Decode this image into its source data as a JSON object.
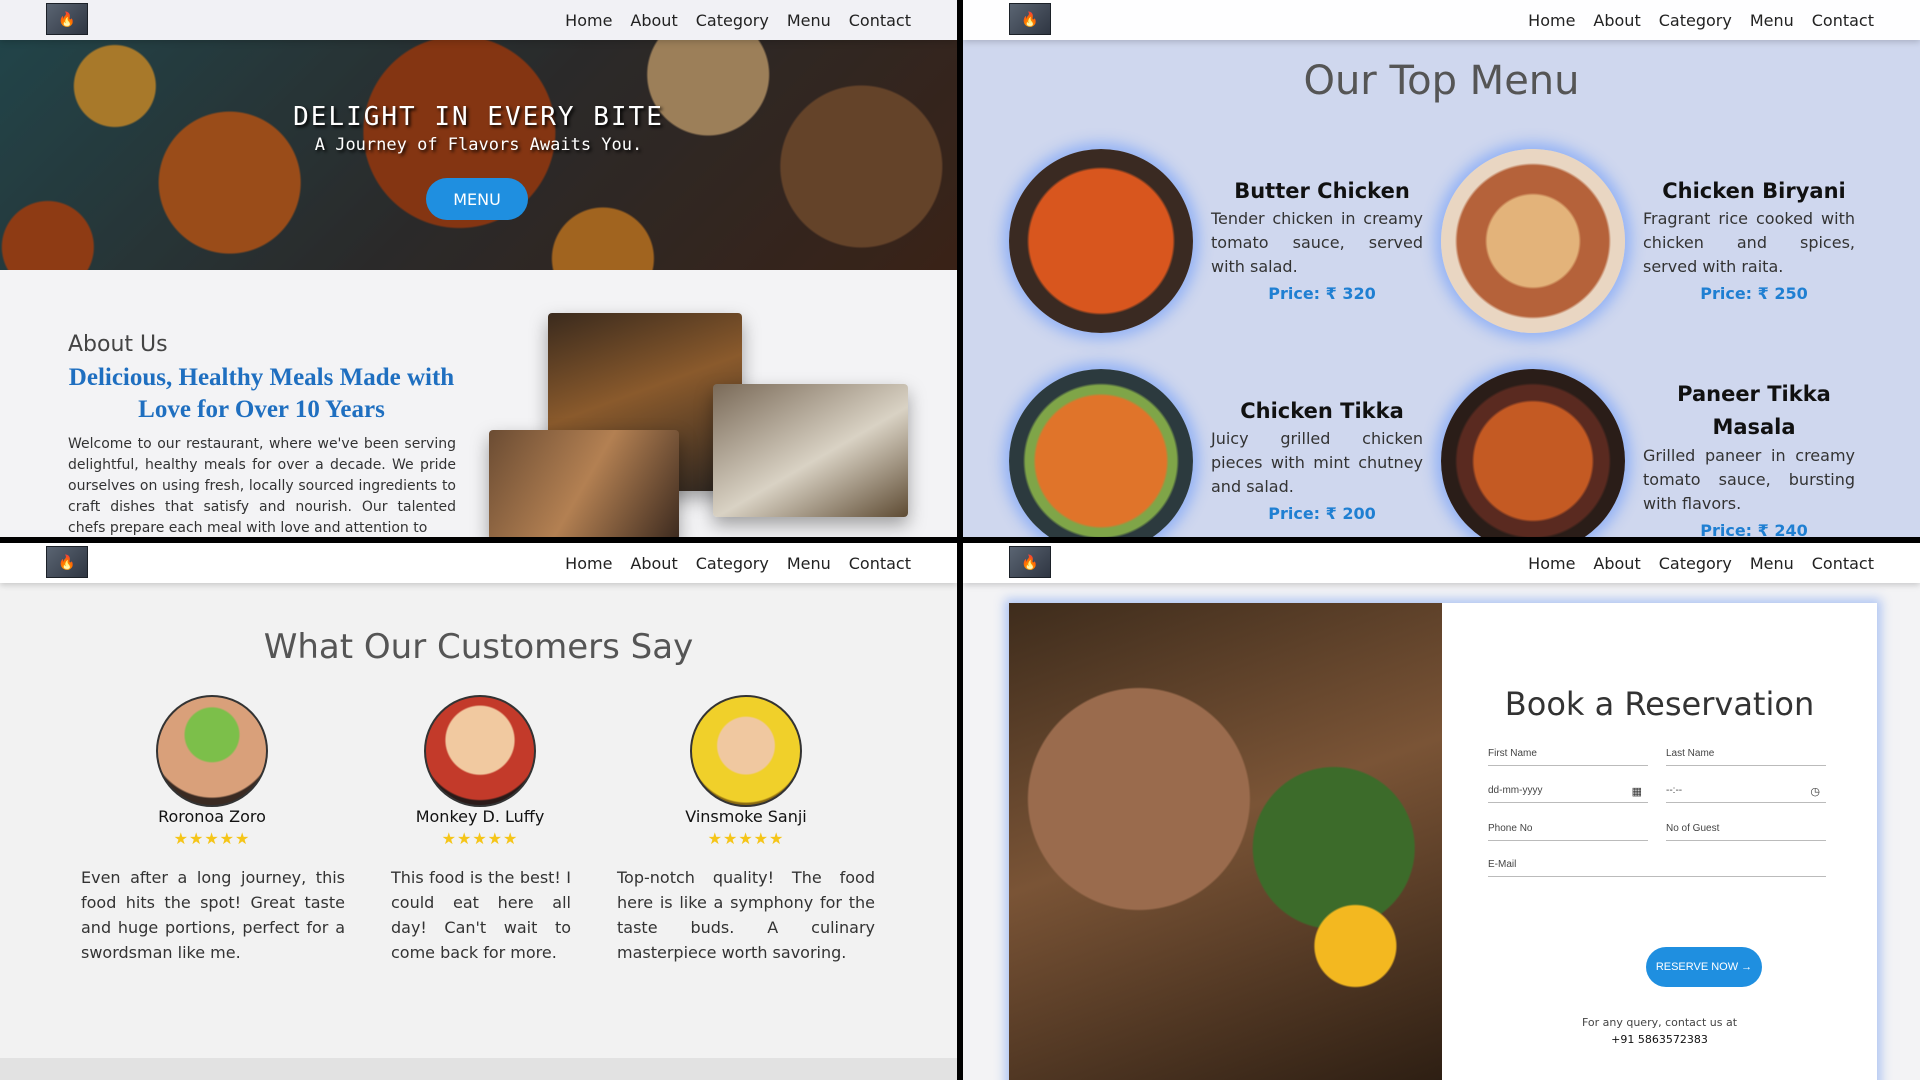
{
  "nav": {
    "links": [
      "Home",
      "About",
      "Category",
      "Menu",
      "Contact"
    ]
  },
  "hero": {
    "title": "DELIGHT IN EVERY BITE",
    "subtitle": "A Journey of Flavors Awaits You.",
    "button": "MENU"
  },
  "about": {
    "heading": "About Us",
    "title": "Delicious, Healthy Meals Made with Love for Over 10 Years",
    "body": "Welcome to our restaurant, where we've been serving delightful, healthy meals for over a decade. We pride ourselves on using fresh, locally sourced ingredients to craft dishes that satisfy and nourish. Our talented chefs prepare each meal with love and attention to"
  },
  "menu": {
    "title": "Our Top Menu",
    "items": [
      {
        "name": "Butter Chicken",
        "desc": "Tender chicken in creamy tomato sauce, served with salad.",
        "price": "Price: ₹ 320"
      },
      {
        "name": "Chicken Biryani",
        "desc": "Fragrant rice cooked with chicken and spices, served with raita.",
        "price": "Price: ₹ 250"
      },
      {
        "name": "Chicken Tikka",
        "desc": "Juicy grilled chicken pieces with mint chutney and salad.",
        "price": "Price: ₹ 200"
      },
      {
        "name": "Paneer Tikka Masala",
        "desc": "Grilled paneer in creamy tomato sauce, bursting with flavors.",
        "price": "Price: ₹ 240"
      }
    ]
  },
  "testimonials": {
    "title": "What Our Customers Say",
    "items": [
      {
        "name": "Roronoa Zoro",
        "stars": "★★★★★",
        "quote": "Even after a long journey, this food hits the spot! Great taste and huge portions, perfect for a swordsman like me."
      },
      {
        "name": "Monkey D. Luffy",
        "stars": "★★★★★",
        "quote": "This food is the best! I could eat here all day! Can't wait to come back for more."
      },
      {
        "name": "Vinsmoke Sanji",
        "stars": "★★★★★",
        "quote": "Top-notch quality! The food here is like a symphony for the taste buds. A culinary masterpiece worth savoring."
      }
    ]
  },
  "reservation": {
    "title": "Book a Reservation",
    "fields": {
      "first_name": "First Name",
      "last_name": "Last Name",
      "date": "dd-mm-yyyy",
      "time": "--:--",
      "phone": "Phone No",
      "guests": "No of Guest",
      "email": "E-Mail"
    },
    "button": "RESERVE NOW →",
    "contact_label": "For any query, contact us at",
    "contact_phone": "+91 5863572383"
  },
  "colors": {
    "accent": "#1f8fe0",
    "price": "#1f7fd2",
    "star": "#f5c518",
    "menu_bg": "#cfd7ee"
  }
}
